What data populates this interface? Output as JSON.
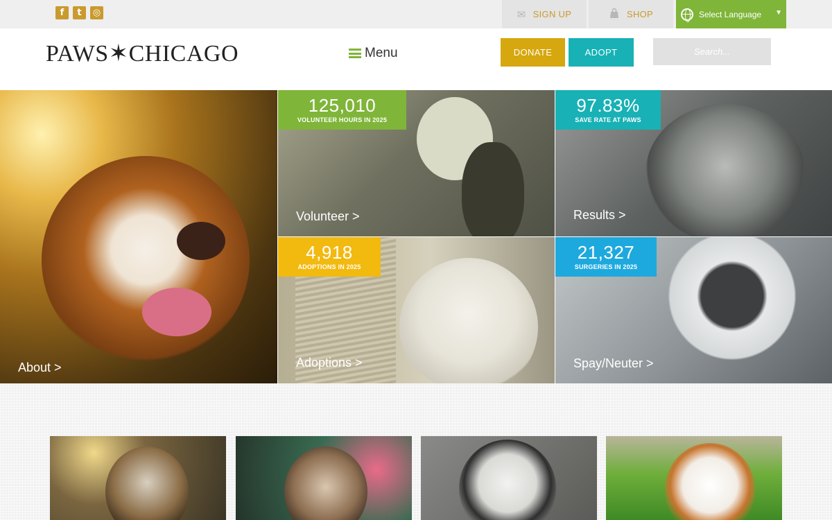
{
  "colors": {
    "gold": "#c99a2e",
    "green": "#7fb539",
    "teal": "#18b1b5",
    "yellow": "#f2b90f",
    "blue": "#1ea9de",
    "donate": "#d6a70f"
  },
  "topbar": {
    "social": [
      {
        "icon": "facebook-icon",
        "glyph": "f"
      },
      {
        "icon": "twitter-icon",
        "glyph": "t"
      },
      {
        "icon": "instagram-icon",
        "glyph": "◎"
      }
    ],
    "signup_label": "SIGN UP",
    "shop_label": "SHOP",
    "language_label": "Select Language"
  },
  "header": {
    "logo": "PAWS✶CHICAGO",
    "menu_label": "Menu",
    "donate_label": "DONATE",
    "adopt_label": "ADOPT",
    "search_placeholder": "Search..."
  },
  "hero": {
    "about": {
      "label": "About >"
    },
    "volunteer": {
      "number": "125,010",
      "caption": "VOLUNTEER HOURS IN 2025",
      "label": "Volunteer >"
    },
    "results": {
      "number": "97.83%",
      "caption": "SAVE RATE AT PAWS",
      "label": "Results >"
    },
    "adoptions": {
      "number": "4,918",
      "caption": "ADOPTIONS IN 2025",
      "label": "Adoptions >"
    },
    "spay": {
      "number": "21,327",
      "caption": "SURGERIES IN 2025",
      "label": "Spay/Neuter >"
    }
  }
}
